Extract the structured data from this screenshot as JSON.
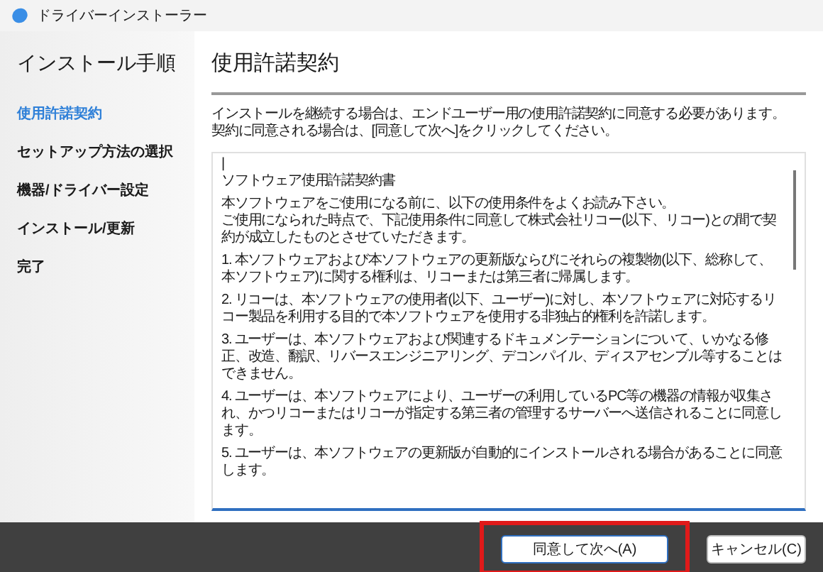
{
  "window": {
    "title": "ドライバーインストーラー"
  },
  "sidebar": {
    "title": "インストール手順",
    "steps": [
      {
        "label": "使用許諾契約",
        "selected": true
      },
      {
        "label": "セットアップ方法の選択",
        "selected": false
      },
      {
        "label": "機器/ドライバー設定",
        "selected": false
      },
      {
        "label": "インストール/更新",
        "selected": false
      },
      {
        "label": "完了",
        "selected": false
      }
    ]
  },
  "main": {
    "heading": "使用許諾契約",
    "instructions": [
      "インストールを継続する場合は、エンドユーザー用の使用許諾契約に同意する必要があります。",
      "契約に同意される場合は、[同意して次へ]をクリックしてください。"
    ],
    "license": {
      "cursor": "|",
      "title": "ソフトウェア使用許諾契約書",
      "intro": [
        "本ソフトウェアをご使用になる前に、以下の使用条件をよくお読み下さい。",
        "ご使用になられた時点で、下記使用条件に同意して株式会社リコー(以下、リコー)との間で契約が成立したものとさせていただきます。"
      ],
      "clauses": [
        "1. 本ソフトウェアおよび本ソフトウェアの更新版ならびにそれらの複製物(以下、総称して、本ソフトウェア)に関する権利は、リコーまたは第三者に帰属します。",
        "2. リコーは、本ソフトウェアの使用者(以下、ユーザー)に対し、本ソフトウェアに対応するリコー製品を利用する目的で本ソフトウェアを使用する非独占的権利を許諾します。",
        "3. ユーザーは、本ソフトウェアおよび関連するドキュメンテーションについて、いかなる修正、改造、翻訳、リバースエンジニアリング、デコンパイル、ディスアセンブル等することはできません。",
        "4. ユーザーは、本ソフトウェアにより、ユーザーの利用しているPC等の機器の情報が収集され、かつリコーまたはリコーが指定する第三者の管理するサーバーへ送信されることに同意します。",
        "5. ユーザーは、本ソフトウェアの更新版が自動的にインストールされる場合があることに同意します。"
      ]
    }
  },
  "buttons": [
    {
      "label": "同意して次へ(A)",
      "highlighted": true
    },
    {
      "label": "キャンセル(C)",
      "highlighted": false
    }
  ]
}
